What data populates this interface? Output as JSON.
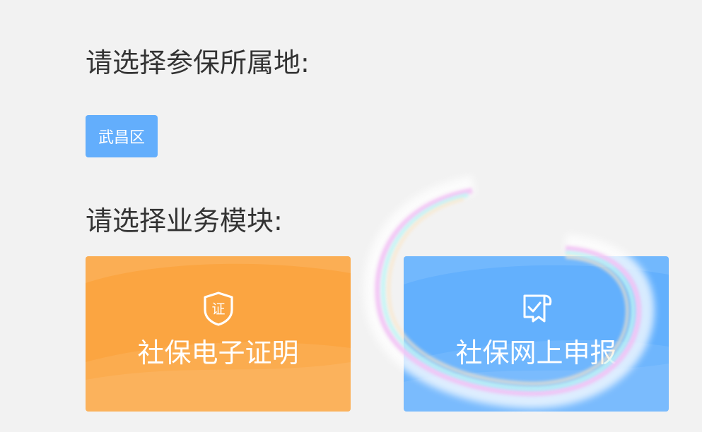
{
  "headings": {
    "region": "请选择参保所属地:",
    "module": "请选择业务模块:"
  },
  "region_chip": {
    "label": "武昌区"
  },
  "modules": [
    {
      "label": "社保电子证明",
      "icon": "certificate-shield-icon",
      "color": "#fba541",
      "icon_text": "证"
    },
    {
      "label": "社保网上申报",
      "icon": "document-check-icon",
      "color": "#63b0fd"
    }
  ],
  "colors": {
    "background": "#f2f2f2",
    "heading_text": "#333333",
    "chip_bg": "#63aefc"
  }
}
